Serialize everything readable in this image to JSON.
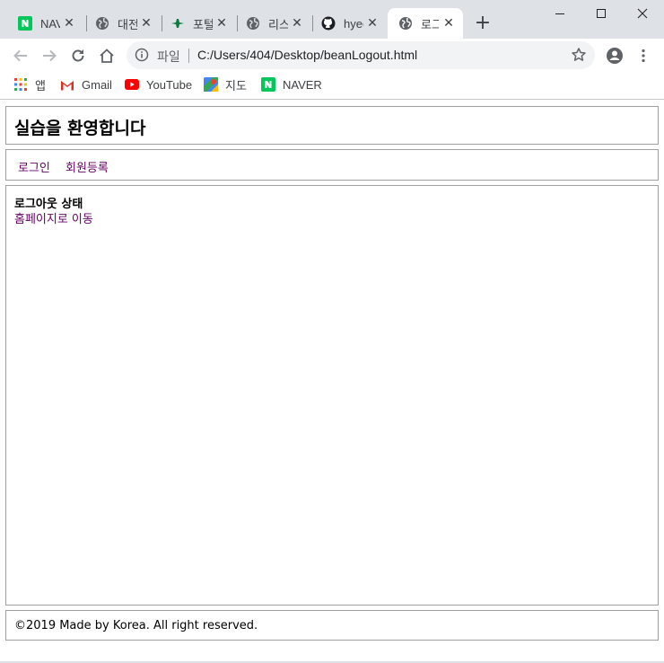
{
  "browser": {
    "tabs": [
      {
        "label": "NAVER",
        "icon": "naver-icon"
      },
      {
        "label": "대전",
        "icon": "globe-icon"
      },
      {
        "label": "포털",
        "icon": "plane-icon"
      },
      {
        "label": "리스",
        "icon": "globe-icon"
      },
      {
        "label": "hyeo",
        "icon": "github-icon"
      },
      {
        "label": "로그",
        "icon": "globe-icon",
        "active": true
      }
    ],
    "new_tab_glyph": "+",
    "address": {
      "scheme_label": "파일",
      "url": "C:/Users/404/Desktop/beanLogout.html"
    },
    "bookmarks": [
      {
        "label": "앱",
        "icon": "apps-grid-icon"
      },
      {
        "label": "Gmail",
        "icon": "gmail-icon"
      },
      {
        "label": "YouTube",
        "icon": "youtube-icon"
      },
      {
        "label": "지도",
        "icon": "maps-icon"
      },
      {
        "label": "NAVER",
        "icon": "naver-icon"
      }
    ],
    "colors": {
      "tabstrip": "#dee1e6",
      "omnibox": "#f1f3f4",
      "naver": "#03c75a",
      "youtube": "#ff0000"
    }
  },
  "page": {
    "header_title": "실습을 환영합니다",
    "nav": {
      "login": "로그인",
      "register": "회원등록"
    },
    "status": "로그아웃 상태",
    "home_link": "홈페이지로 이동",
    "footer": "©2019 Made by Korea. All right reserved.",
    "colors": {
      "link": "#660066",
      "border": "#9e9e9e"
    }
  }
}
